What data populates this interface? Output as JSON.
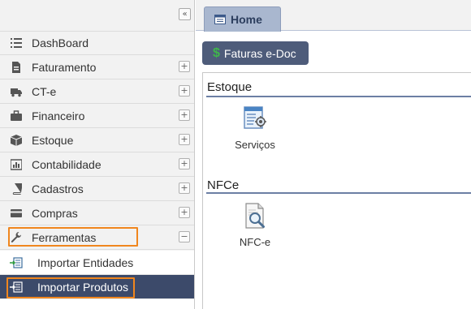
{
  "sidebar": {
    "collapse_symbol": "«",
    "menu": [
      {
        "label": "DashBoard",
        "icon": "list-icon",
        "expand": ""
      },
      {
        "label": "Faturamento",
        "icon": "document-icon",
        "expand": "+"
      },
      {
        "label": "CT-e",
        "icon": "truck-icon",
        "expand": "+"
      },
      {
        "label": "Financeiro",
        "icon": "briefcase-icon",
        "expand": "+"
      },
      {
        "label": "Estoque",
        "icon": "box-icon",
        "expand": "+"
      },
      {
        "label": "Contabilidade",
        "icon": "bar-chart-icon",
        "expand": "+"
      },
      {
        "label": "Cadastros",
        "icon": "book-icon",
        "expand": "+"
      },
      {
        "label": "Compras",
        "icon": "credit-card-icon",
        "expand": "+"
      },
      {
        "label": "Ferramentas",
        "icon": "wrench-icon",
        "expand": "−"
      }
    ],
    "submenu": [
      {
        "label": "Importar Entidades",
        "icon": "import-icon",
        "active": false
      },
      {
        "label": "Importar Produtos",
        "icon": "import-icon",
        "active": true
      }
    ],
    "highlight_color": "#f0861e",
    "active_color": "#3c4a6a"
  },
  "tabs": [
    {
      "label": "Home",
      "icon": "home-tab-icon"
    }
  ],
  "main": {
    "faturas_button": {
      "symbol": "$",
      "label": "Faturas e-Doc"
    },
    "sections": [
      {
        "title": "Estoque",
        "items": [
          {
            "label": "Serviços",
            "icon": "services-icon"
          }
        ]
      },
      {
        "title": "NFCe",
        "items": [
          {
            "label": "NFC-e",
            "icon": "nfce-icon"
          }
        ]
      }
    ]
  }
}
